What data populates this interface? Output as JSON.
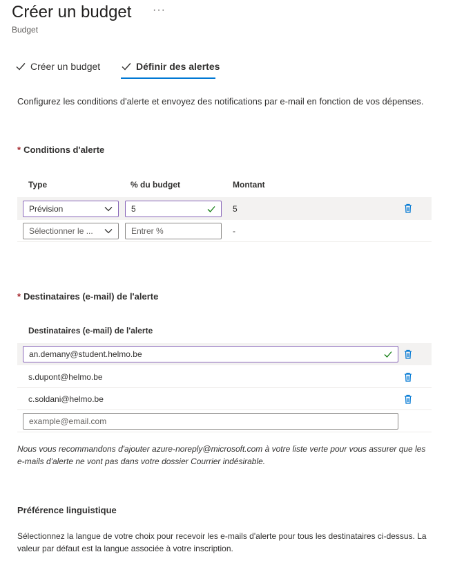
{
  "header": {
    "title": "Créer un budget",
    "more_label": "···",
    "subtitle": "Budget"
  },
  "steps": [
    {
      "label": "Créer un budget",
      "completed": true
    },
    {
      "label": "Définir des alertes",
      "completed": true,
      "active": true
    }
  ],
  "description": "Configurez les conditions d'alerte et envoyez des notifications par e-mail en fonction de vos dépenses.",
  "conditions": {
    "section_title": "Conditions d'alerte",
    "required_mark": "*",
    "columns": {
      "type": "Type",
      "percent": "% du budget",
      "amount": "Montant"
    },
    "rows": [
      {
        "type": "Prévision",
        "percent": "5",
        "amount": "5"
      },
      {
        "type_placeholder": "Sélectionner le ...",
        "percent_placeholder": "Entrer %",
        "amount": "-"
      }
    ]
  },
  "recipients": {
    "section_title": "Destinataires (e-mail) de l'alerte",
    "required_mark": "*",
    "column_header": "Destinataires (e-mail) de l'alerte",
    "emails": [
      "an.demany@student.helmo.be",
      "s.dupont@helmo.be",
      "c.soldani@helmo.be"
    ],
    "new_email_placeholder": "example@email.com",
    "note": "Nous vous recommandons d'ajouter azure-noreply@microsoft.com à votre liste verte pour vous assurer que les e-mails d'alerte ne vont pas dans votre dossier Courrier indésirable."
  },
  "language": {
    "section_title": "Préférence linguistique",
    "description": "Sélectionnez la langue de votre choix pour recevoir les e-mails d'alerte pour tous les destinataires ci-dessus. La valeur par défaut est la langue associée à votre inscription."
  },
  "colors": {
    "accent": "#0078d4",
    "focus_border": "#8764b8",
    "success": "#107c10",
    "required": "#a4262c"
  },
  "icons": {
    "step_check": "checkmark-icon",
    "dropdown": "chevron-down-icon",
    "valid": "checkmark-icon",
    "delete": "trash-icon"
  }
}
